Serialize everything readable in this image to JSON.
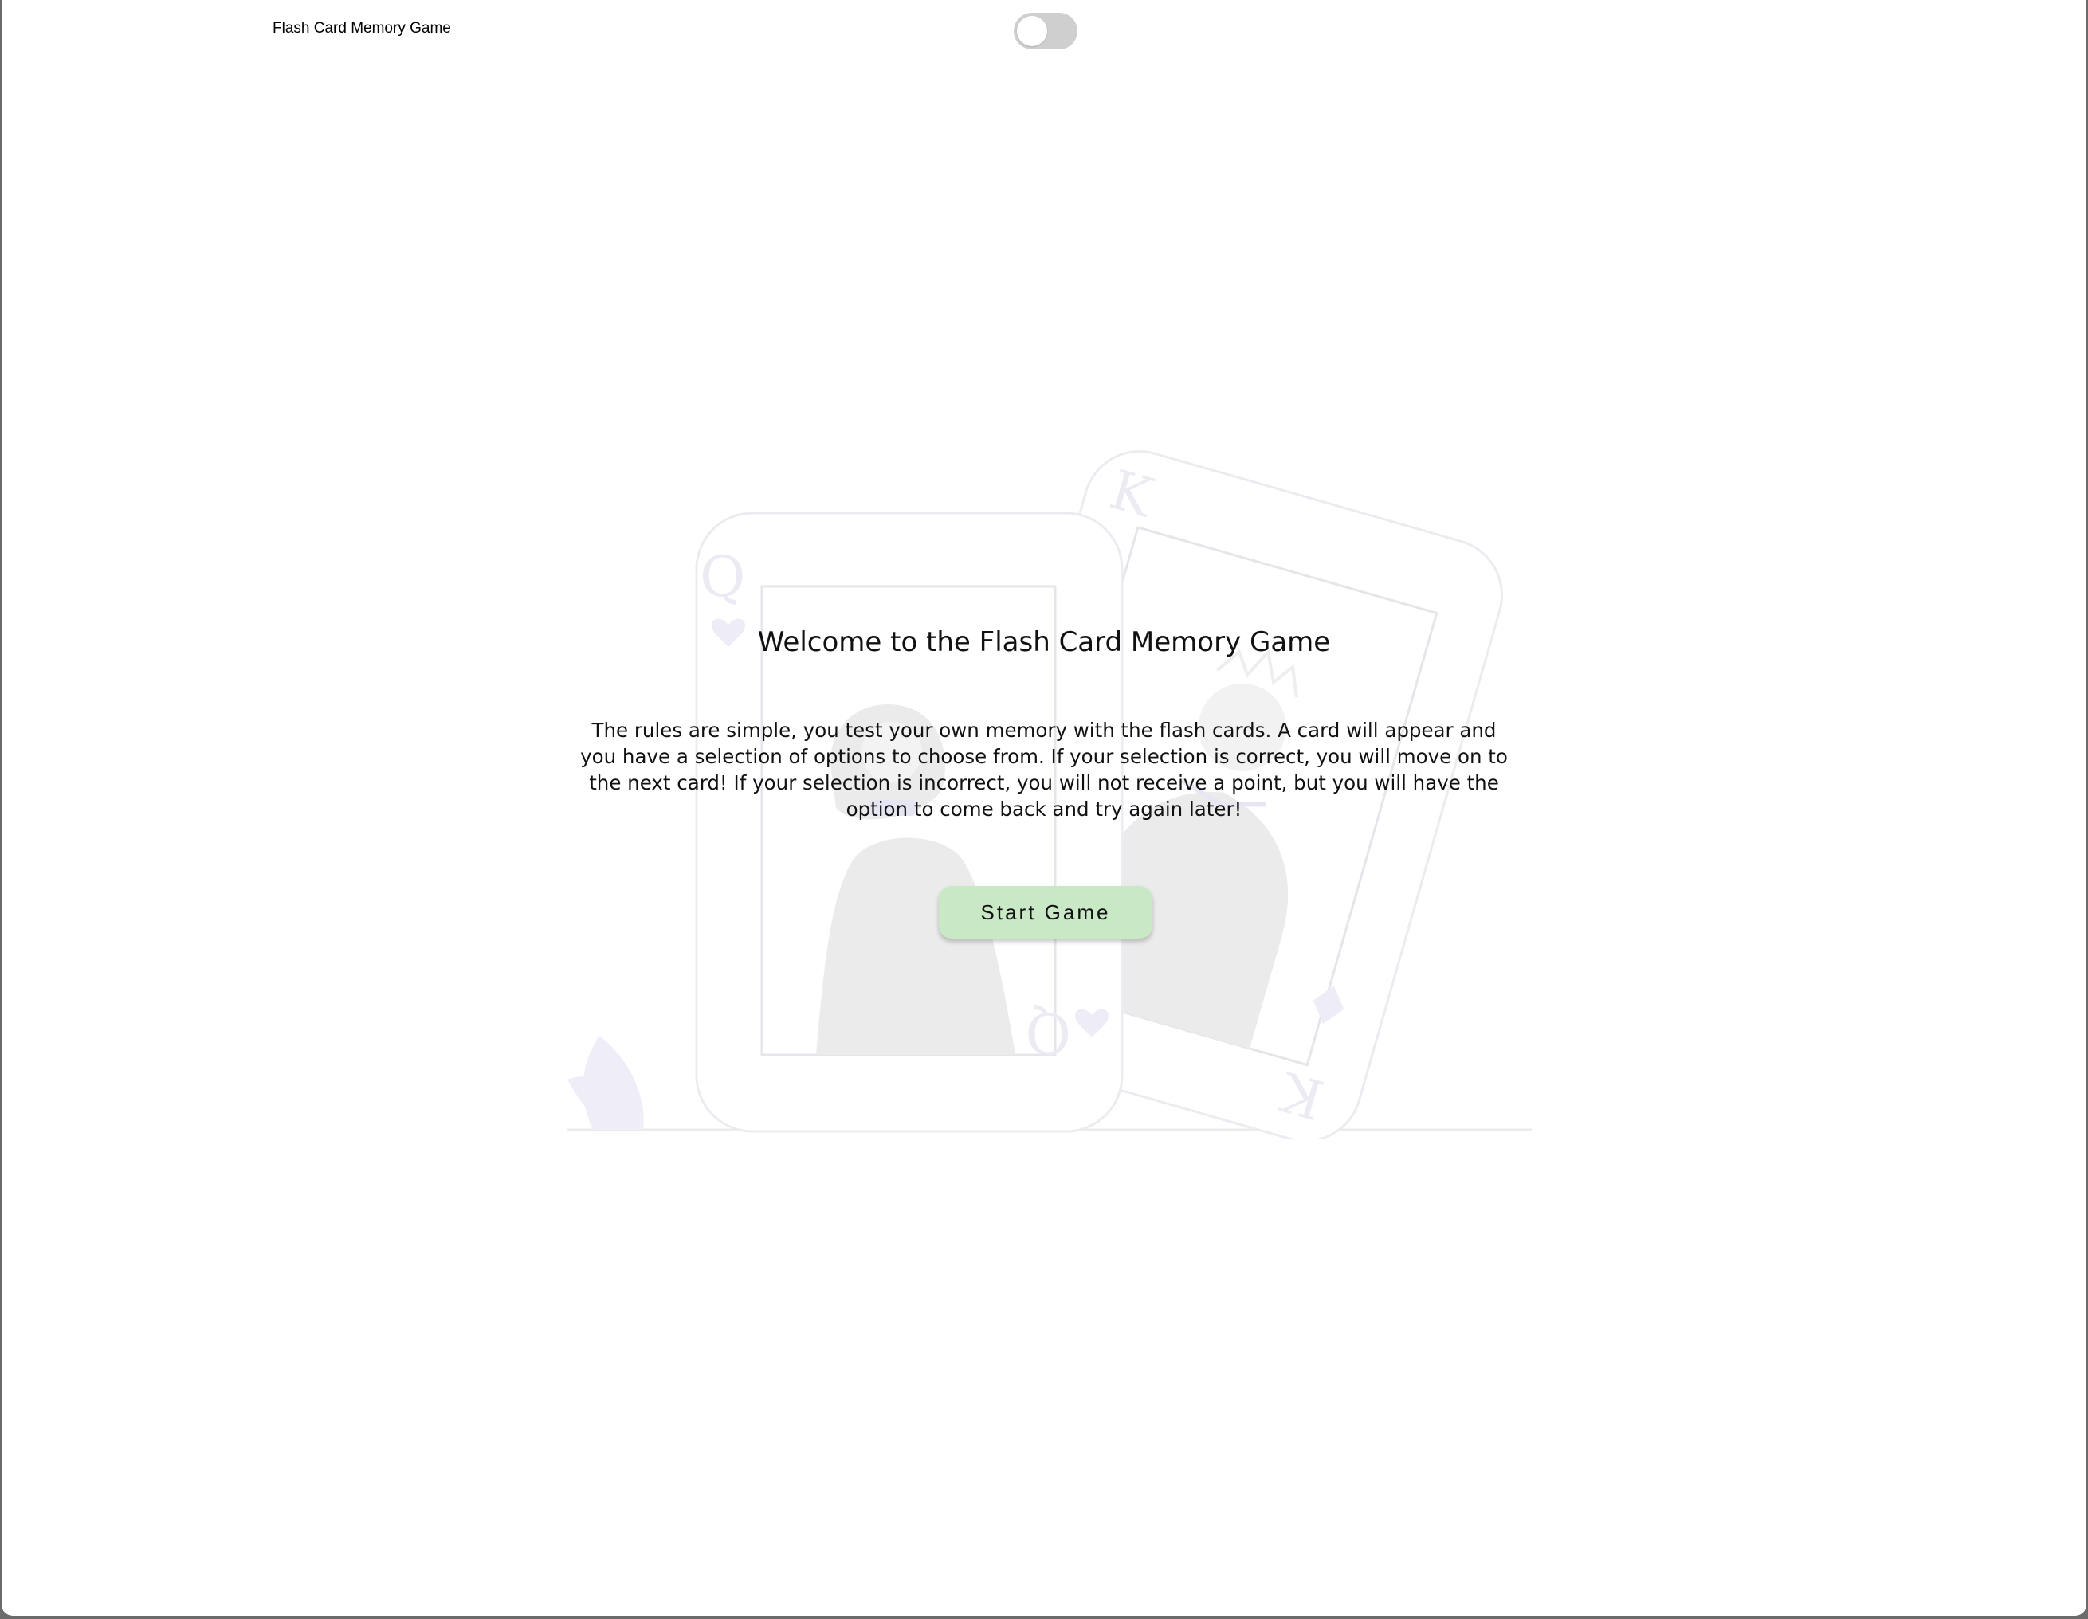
{
  "header": {
    "app_title": "Flash Card Memory Game",
    "theme_toggle": {
      "state": "off"
    }
  },
  "main": {
    "title": "Welcome to the Flash Card Memory Game",
    "rules": "The rules are simple, you test your own memory with the flash cards. A card will appear and you have a selection of options to choose from. If your selection is correct, you will move on to the next card! If your selection is incorrect, you will not receive a point, but you will have the option to come back and try again later!",
    "start_button_label": "Start Game"
  },
  "illustration": {
    "queen_card": {
      "rank": "Q",
      "suit": "hearts"
    },
    "king_card": {
      "rank": "K",
      "suit": "diamonds"
    }
  },
  "colors": {
    "start_button": "#c8e8c6",
    "toggle_off": "#cfcfcf",
    "illustration_stroke": "#ececf0",
    "illustration_accent": "#eeedf7"
  }
}
